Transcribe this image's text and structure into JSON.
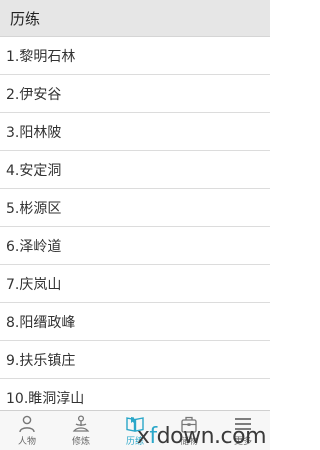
{
  "header": {
    "title": "历练"
  },
  "locations": [
    "1.黎明石林",
    "2.伊安谷",
    "3.阳林陂",
    "4.安定洞",
    "5.彬源区",
    "6.泽岭道",
    "7.庆岚山",
    "8.阳缙政峰",
    "9.扶乐镇庄",
    "10.睢洞淳山"
  ],
  "tabs": [
    {
      "label": "人物",
      "icon": "person-icon"
    },
    {
      "label": "修炼",
      "icon": "meditation-icon"
    },
    {
      "label": "历练",
      "icon": "book-icon",
      "active": true
    },
    {
      "label": "储物",
      "icon": "backpack-icon"
    },
    {
      "label": "更多",
      "icon": "menu-icon"
    }
  ],
  "colors": {
    "accent": "#2aa7c9",
    "header_bg": "#e6e6e6"
  },
  "watermark": {
    "prefix": "x",
    "highlight": "f",
    "rest": "down.com"
  }
}
